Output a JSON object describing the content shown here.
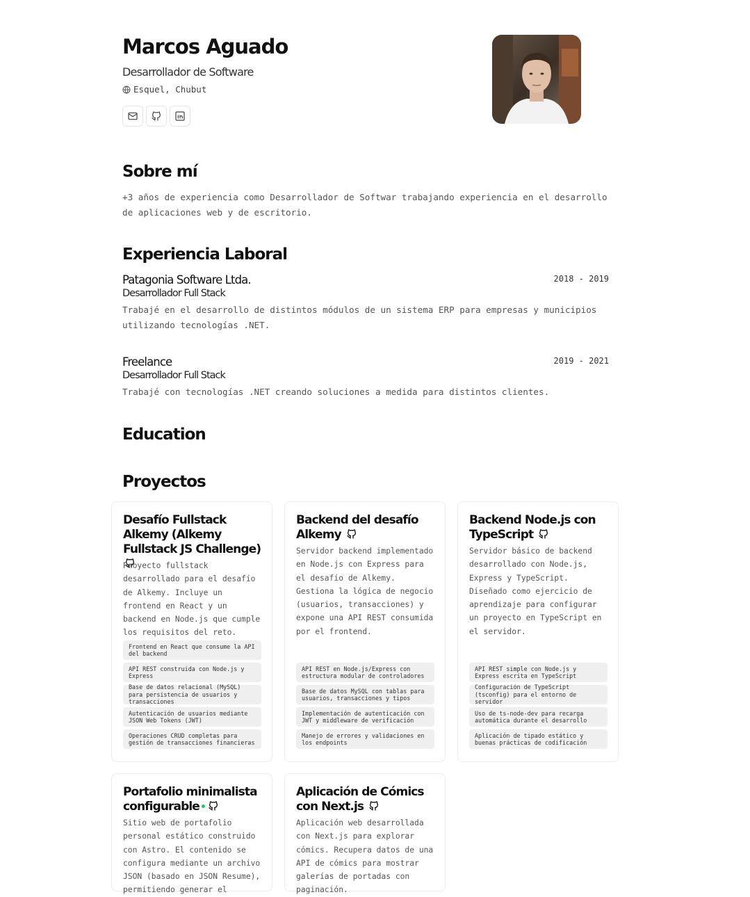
{
  "header": {
    "name": "Marcos Aguado",
    "role": "Desarrollador de Software",
    "location": "Esquel, Chubut",
    "links": [
      {
        "icon": "mail-icon"
      },
      {
        "icon": "github-icon"
      },
      {
        "icon": "linkedin-icon"
      }
    ]
  },
  "about": {
    "title": "Sobre mí",
    "text": "+3 años de experiencia como Desarrollador de Softwar trabajando experiencia en el desarrollo de aplicaciones web y de escritorio."
  },
  "experience": {
    "title": "Experiencia Laboral",
    "jobs": [
      {
        "company": "Patagonia Software Ltda.",
        "position": "Desarrollador Full Stack",
        "dates": "2018 - 2019",
        "summary": "Trabajé en el desarrollo de distintos módulos de un sistema ERP para empresas y municipios utilizando tecnologías .NET."
      },
      {
        "company": "Freelance",
        "position": "Desarrollador Full Stack",
        "dates": "2019 - 2021",
        "summary": "Trabajé con tecnologías .NET creando soluciones a medida para distintos clientes."
      }
    ]
  },
  "education": {
    "title": "Education"
  },
  "projects": {
    "title": "Proyectos",
    "items": [
      {
        "title": "Desafío Fullstack Alkemy (Alkemy Fullstack JS Challenge)",
        "description": "Proyecto fullstack desarrollado para el desafío de Alkemy. Incluye un frontend en React y un backend en Node.js que cumple los requisitos del reto.",
        "highlights": [
          "Frontend en React que consume la API del backend",
          "API REST construida con Node.js y Express",
          "Base de datos relacional (MySQL) para persistencia de usuarios y transacciones",
          "Autenticación de usuarios mediante JSON Web Tokens (JWT)",
          "Operaciones CRUD completas para gestión de transacciones financieras"
        ]
      },
      {
        "title": "Backend del desafío Alkemy",
        "description": "Servidor backend implementado en Node.js con Express para el desafío de Alkemy. Gestiona la lógica de negocio (usuarios, transacciones) y expone una API REST consumida por el frontend.",
        "highlights": [
          "API REST en Node.js/Express con estructura modular de controladores",
          "Base de datos MySQL con tablas para usuarios, transacciones y tipos",
          "Implementación de autenticación con JWT y middleware de verificación",
          "Manejo de errores y validaciones en los endpoints"
        ]
      },
      {
        "title": "Backend Node.js con TypeScript",
        "description": "Servidor básico de backend desarrollado con Node.js, Express y TypeScript. Diseñado como ejercicio de aprendizaje para configurar un proyecto en TypeScript en el servidor.",
        "highlights": [
          "API REST simple con Node.js y Express escrita en TypeScript",
          "Configuración de TypeScript (tsconfig) para el entorno de servidor",
          "Uso de ts-node-dev para recarga automática durante el desarrollo",
          "Aplicación de tipado estático y buenas prácticas de codificación"
        ]
      },
      {
        "title": "Portafolio minimalista configurable",
        "description": "Sitio web de portafolio personal estático construido con Astro. El contenido se configura mediante un archivo JSON (basado en JSON Resume), permitiendo generar el",
        "highlights": []
      },
      {
        "title": "Aplicación de Cómics con Next.js",
        "description": "Aplicación web desarrollada con Next.js para explorar cómics. Recupera datos de una API de cómics para mostrar galerías de portadas con paginación.",
        "highlights": []
      }
    ]
  }
}
